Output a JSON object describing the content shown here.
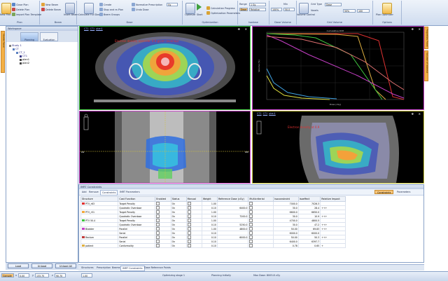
{
  "ribbon": {
    "groups": [
      {
        "label": "Plan",
        "buttons": [
          "New Plan",
          "Close Plan",
          "Delete Plan",
          "Import Plan Template"
        ]
      },
      {
        "label": "Beam",
        "buttons": [
          "New Beam",
          "Delete Beam",
          "Insert Beam",
          "Beam"
        ]
      },
      {
        "label": "Dose",
        "buttons": [
          "Calculate Full Dose",
          "Create",
          "Stop and re-Plan",
          "Beam Groups",
          "Normalize Prescription",
          "Undo Dose"
        ]
      },
      {
        "label": "Optimization",
        "buttons": [
          "Optimize",
          "Start",
          "Calculation Progress",
          "Optimization Parameters"
        ]
      },
      {
        "label": "Isodose",
        "buttons": [
          "Range",
          "Dose",
          "Relative"
        ]
      },
      {
        "label": "Dose Volume",
        "buttons": [
          "Min",
          "Max"
        ]
      },
      {
        "label": "Grid Volume",
        "buttons": [
          "Grid Type",
          "Dose",
          "Voxels",
          "Volume Control"
        ]
      },
      {
        "label": "Options",
        "buttons": [
          "Plan Optimizer"
        ]
      }
    ],
    "inputs": {
      "dose_unit": "Gy",
      "grid": "1 Gy",
      "grid_value": "50%",
      "iso_value": "100",
      "iso_max": "50.0",
      "dv_min": "100%",
      "grid_type": "Dose"
    }
  },
  "workspace": {
    "title": "Workspace",
    "tabs": [
      "Planning",
      "Evaluation"
    ],
    "tree": [
      "Study 1",
      "CT",
      "CT_1",
      "CT1",
      "plan1",
      "plan2"
    ],
    "buttons": [
      "Load",
      "Unload",
      "Unload All"
    ]
  },
  "side_strips": {
    "left": "Mantis Panel",
    "right_top": "Properties Panel",
    "right_mid": "Volume of Interest"
  },
  "viewers": [
    {
      "id": "view1",
      "header": [
        "CT1",
        "CT1",
        "plan1"
      ],
      "overlay": "Electron density override: 0.9 g/cm³ (overlap)"
    },
    {
      "id": "view2",
      "header": [],
      "overlay": ""
    },
    {
      "id": "view3",
      "header": [],
      "overlay": ""
    },
    {
      "id": "view4",
      "header": [
        "CT1",
        "CT1",
        "plan1"
      ],
      "overlay": "Electron density at 0.9"
    }
  ],
  "crosshair_labels": {
    "left": "LW",
    "right": "RW"
  },
  "dvh": {
    "title": "Cumulative DVH",
    "xlabel": "Dose (cGy)",
    "ylabel": "Volume (%)"
  },
  "imrt": {
    "title": "IMRT Constraints",
    "toolbar_tabs": [
      "Add",
      "Remove",
      "Constraints",
      "IMRT Parameters"
    ],
    "right_buttons": [
      "Constraints",
      "Parameters"
    ],
    "columns": [
      "Structure",
      "Cost Function",
      "Enabled",
      "Status",
      "Manual",
      "Weight",
      "Reference Dose (cGy)",
      "Multicriterial",
      "Isoconstraint",
      "Isoeffect",
      "Relative Impact"
    ],
    "rows": [
      {
        "structure": "PTV_r63",
        "color": "#e03232",
        "cost": "Target Penalty",
        "status": "On",
        "weight": "1.00",
        "ref": "",
        "isocon": "7000.0",
        "isoeff": "7026.3",
        "impact": ""
      },
      {
        "structure": "",
        "color": "",
        "cost": "Quadratic Overdose",
        "status": "On",
        "weight": "0.10",
        "ref": "6400.0",
        "isocon": "30.0",
        "isoeff": "28.4",
        "impact": "+++"
      },
      {
        "structure": "PTV_r51",
        "color": "#f2a93b",
        "cost": "Target Penalty",
        "status": "On",
        "weight": "1.00",
        "ref": "",
        "isocon": "6600.0",
        "isoeff": "6650.0",
        "impact": ""
      },
      {
        "structure": "",
        "color": "",
        "cost": "Quadratic Overdose",
        "status": "On",
        "weight": "0.10",
        "ref": "7200.0",
        "isocon": "30.0",
        "isoeff": "10.9",
        "impact": "+++"
      },
      {
        "structure": "PTV 50.4",
        "color": "#39c73b",
        "cost": "Target Penalty",
        "status": "On",
        "weight": "1.00",
        "ref": "",
        "isocon": "4700.0",
        "isoeff": "4800.5",
        "impact": ""
      },
      {
        "structure": "",
        "color": "",
        "cost": "Quadratic Overdose",
        "status": "On",
        "weight": "0.10",
        "ref": "5250.0",
        "isocon": "30.0",
        "isoeff": "47.2",
        "impact": "+++"
      },
      {
        "structure": "Bladder",
        "color": "#c63fc6",
        "cost": "Parallel",
        "status": "On",
        "weight": "1.00",
        "ref": "4800.0",
        "isocon": "50.00",
        "isoeff": "69.83",
        "impact": "+++"
      },
      {
        "structure": "",
        "color": "",
        "cost": "Serial",
        "status": "On",
        "weight": "0.10",
        "ref": "",
        "isocon": "6000.0",
        "isoeff": "6000.0",
        "impact": ""
      },
      {
        "structure": "Rectum",
        "color": "#c03b3b",
        "cost": "Parallel",
        "status": "On",
        "weight": "0.10",
        "ref": "6000.0",
        "isocon": "50.00",
        "isoeff": "50.3",
        "impact": "+++"
      },
      {
        "structure": "",
        "color": "",
        "cost": "Serial",
        "status": "On",
        "weight": "0.10",
        "ref": "",
        "isocon": "6400.0",
        "isoeff": "6397.7",
        "impact": ""
      },
      {
        "structure": "patient",
        "color": "#e0b040",
        "cost": "Conformality",
        "status": "On",
        "weight": "0.10",
        "ref": "",
        "isocon": "0.78",
        "isoeff": "0.65",
        "impact": "+"
      }
    ]
  },
  "bottom_tabs": [
    "Structures",
    "Prescription",
    "Beams",
    "IMRT Constraints",
    "Dose Reference Points"
  ],
  "status": {
    "fields": [
      "Console",
      "x",
      "y",
      "z"
    ],
    "values": [
      "0.00",
      "133.75",
      "90.70"
    ],
    "misc": "1.00",
    "msg1": "Optimizing stage 1",
    "msg2": "Planning Initially",
    "msg3": "Max Dose: 8005.8 cGy"
  }
}
